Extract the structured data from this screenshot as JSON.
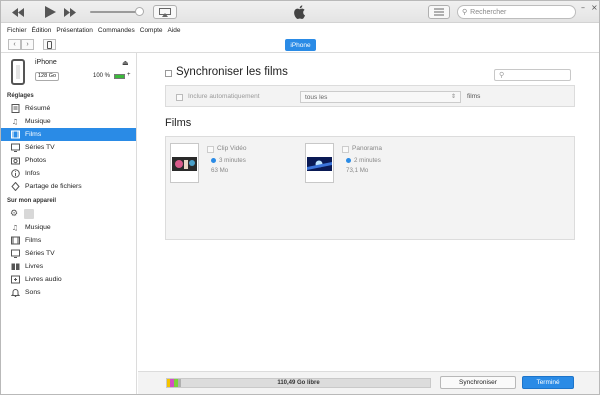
{
  "search": {
    "placeholder": "Rechercher"
  },
  "menu": [
    "Fichier",
    "Édition",
    "Présentation",
    "Commandes",
    "Compte",
    "Aide"
  ],
  "device_tab": "iPhone",
  "device": {
    "name": "iPhone",
    "capacity": "128 Go",
    "battery": "100 %"
  },
  "sidebar": {
    "settings_header": "Réglages",
    "settings": [
      {
        "label": "Résumé",
        "icon": "summary-icon"
      },
      {
        "label": "Musique",
        "icon": "music-icon"
      },
      {
        "label": "Films",
        "icon": "film-icon",
        "selected": true
      },
      {
        "label": "Séries TV",
        "icon": "tv-icon"
      },
      {
        "label": "Photos",
        "icon": "camera-icon"
      },
      {
        "label": "Infos",
        "icon": "info-icon"
      },
      {
        "label": "Partage de fichiers",
        "icon": "apps-icon"
      }
    ],
    "ondevice_header": "Sur mon appareil",
    "ondevice": [
      {
        "label": "Musique",
        "icon": "music-icon"
      },
      {
        "label": "Films",
        "icon": "film-icon"
      },
      {
        "label": "Séries TV",
        "icon": "tv-icon"
      },
      {
        "label": "Livres",
        "icon": "book-icon"
      },
      {
        "label": "Livres audio",
        "icon": "audiobook-icon"
      },
      {
        "label": "Sons",
        "icon": "bell-icon"
      }
    ]
  },
  "main": {
    "sync_title": "Synchroniser les films",
    "include_label": "Inclure automatiquement",
    "include_select": "tous les",
    "include_after": "films",
    "films_title": "Films",
    "films": [
      {
        "name": "Clip Vidéo",
        "duration": "3 minutes",
        "size": "63 Mo"
      },
      {
        "name": "Panorama",
        "duration": "2 minutes",
        "size": "73,1 Mo"
      }
    ]
  },
  "bottom": {
    "free_label": "110,49 Go libre",
    "sync_button": "Synchroniser",
    "done_button": "Terminé",
    "segments": [
      {
        "color": "#f5c400"
      },
      {
        "color": "#d54ec5"
      },
      {
        "color": "#7dd23a"
      },
      {
        "color": "#b0b0b0"
      }
    ]
  },
  "colors": {
    "accent": "#2a8be6"
  }
}
